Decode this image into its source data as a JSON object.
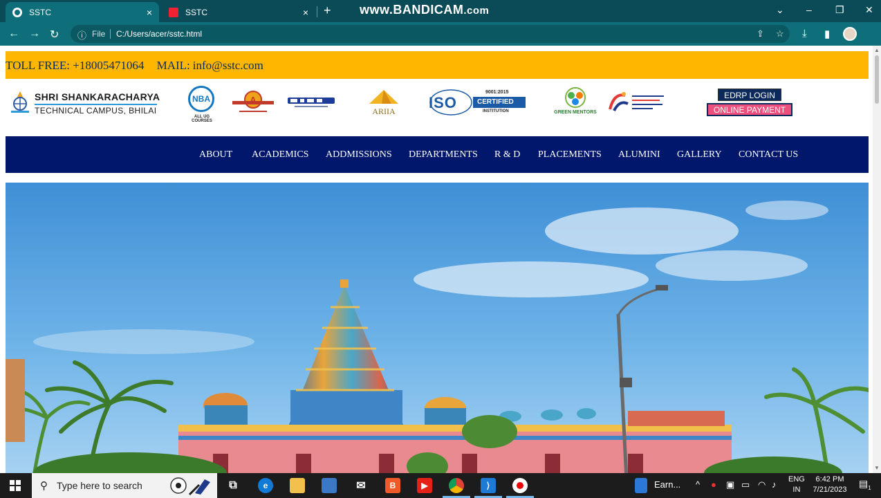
{
  "browser": {
    "tabs": [
      {
        "title": "SSTC",
        "close": "×"
      },
      {
        "title": "SSTC",
        "close": "×"
      }
    ],
    "new_tab": "+",
    "watermark": {
      "main": "www.BANDICAM",
      "suffix": ".com"
    },
    "window_controls": {
      "tab_search": "⌄",
      "minimize": "–",
      "restore": "❐",
      "close": "✕"
    },
    "nav": {
      "back": "←",
      "forward": "→",
      "reload": "↻"
    },
    "address": {
      "info_icon": "ⓘ",
      "scheme_label": "File",
      "url": "C:/Users/acer/sstc.html",
      "share_icon": "⇪",
      "bookmark_icon": "☆"
    },
    "toolbar": {
      "download_icon": "⤓",
      "sidepanel_icon": "▮"
    }
  },
  "site": {
    "contact": {
      "toll_free": "TOLL FREE: +18005471064",
      "mail_label": "MAIL:",
      "mail": "info@sstc.com"
    },
    "brand": {
      "name": "SHRI SHANKARACHARYA",
      "subtitle": "TECHNICAL CAMPUS, BHILAI"
    },
    "logos": {
      "nba": "NBA",
      "nba_caption": "ALL UG COURSES",
      "ariia": "ARIIA",
      "iso": "ISO",
      "iso_badge": "CERTIFIED",
      "iso_year": "9001:2015",
      "iso_sub": "INSTITUTION",
      "green": "GREEN MENTORS"
    },
    "buttons": {
      "edrp_login": "EDRP LOGIN",
      "online_payment": "ONLINE PAYMENT"
    },
    "nav_items": [
      "ABOUT",
      "ACADEMICS",
      "ADDMISSIONS",
      "DEPARTMENTS",
      "R & D",
      "PLACEMENTS",
      "ALUMINI",
      "GALLERY",
      "CONTACT US"
    ],
    "colors": {
      "strip": "#ffb600",
      "nav": "#01176b",
      "payment": "#ef4f7c"
    }
  },
  "taskbar": {
    "search_placeholder": "Type here to search",
    "pinned_label": "Earn...",
    "lang": {
      "line1": "ENG",
      "line2": "IN"
    },
    "time": "6:42 PM",
    "date": "7/21/2023",
    "notification_count": "1"
  }
}
